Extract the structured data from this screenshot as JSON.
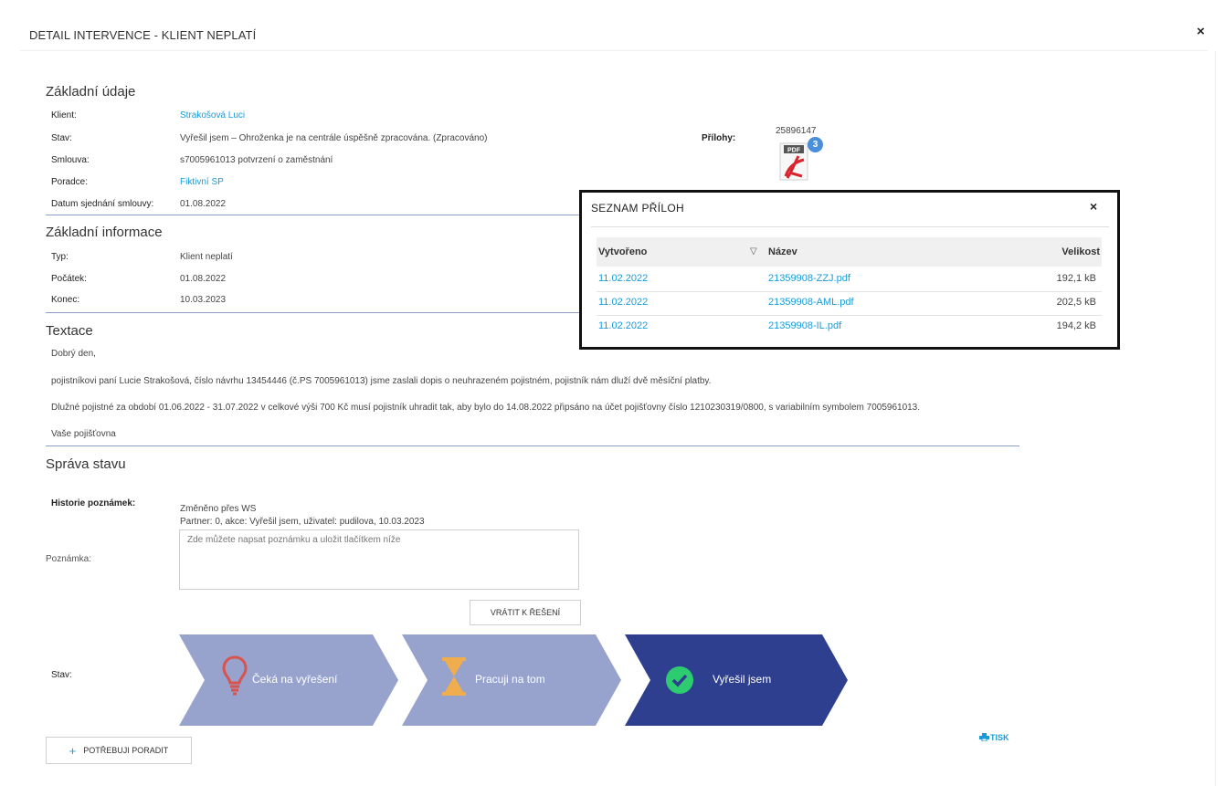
{
  "header": {
    "title": "DETAIL INTERVENCE - KLIENT NEPLATÍ",
    "close_icon": "×"
  },
  "basic": {
    "title": "Základní údaje",
    "fields": [
      {
        "label": "Klient:",
        "value": "Strakošová Luci",
        "link": true
      },
      {
        "label": "Stav:",
        "value": "Vyřešil jsem – Ohroženka je na centrále úspěšně zpracována. (Zpracováno)",
        "link": false
      },
      {
        "label": "Smlouva:",
        "value": "s7005961013 potvrzení o zaměstnání",
        "link": false
      },
      {
        "label": "Poradce:",
        "value": "Fiktivní SP",
        "link": true
      },
      {
        "label": "Datum sjednání smlouvy:",
        "value": "01.08.2022",
        "link": false
      }
    ]
  },
  "attachments": {
    "label": "Přílohy:",
    "number": "25896147",
    "pdf_label": "PDF",
    "count": "3"
  },
  "info": {
    "title": "Základní informace",
    "fields": [
      {
        "label": "Typ:",
        "value": "Klient neplatí"
      },
      {
        "label": "Počátek:",
        "value": "01.08.2022"
      },
      {
        "label": "Konec:",
        "value": "10.03.2023"
      }
    ]
  },
  "textace": {
    "title": "Textace",
    "lines": [
      "Dobrý den,",
      "pojistníkovi paní Lucie Strakošová, číslo návrhu 13454446 (č.PS 7005961013) jsme zaslali dopis o neuhrazeném pojistném, pojistník nám dluží dvě měsíční platby.",
      "Dlužné pojistné za období 01.06.2022 - 31.07.2022 v celkové výši 700 Kč musí pojistník uhradit tak, aby bylo do 14.08.2022 připsáno na účet pojišťovny číslo 1210230319/0800, s variabilním symbolem 7005961013.",
      "Vaše pojišťovna"
    ]
  },
  "sprava": {
    "title": "Správa stavu",
    "history_label": "Historie poznámek:",
    "history_line1": "Změněno přes WS",
    "history_line2": "Partner: 0, akce: Vyřešil jsem, uživatel: pudilova, 10.03.2023",
    "note_label": "Poznámka:",
    "note_placeholder": "Zde můžete napsat poznámku a uložit tlačítkem níže",
    "return_button": "VRÁTIT K ŘEŠENÍ",
    "state_label": "Stav:",
    "steps": [
      {
        "label": "Čeká na vyřešení",
        "icon": "lightbulb-icon",
        "color": "#97a3cd"
      },
      {
        "label": "Pracuji na tom",
        "icon": "hourglass-icon",
        "color": "#97a3cd"
      },
      {
        "label": "Vyřešil jsem",
        "icon": "check-circle-icon",
        "color": "#2e3f8f"
      }
    ],
    "help_button": "POTŘEBUJI PORADIT",
    "help_icon": "+",
    "print_label": "TISK"
  },
  "popup": {
    "title": "SEZNAM  PŘÍLOH",
    "close_icon": "×",
    "sort_icon": "▽",
    "columns": [
      "Vytvořeno",
      "Název",
      "Velikost"
    ],
    "rows": [
      {
        "created": "11.02.2022",
        "name": "21359908-ZZJ.pdf",
        "size": "192,1 kB"
      },
      {
        "created": "11.02.2022",
        "name": "21359908-AML.pdf",
        "size": "202,5 kB"
      },
      {
        "created": "11.02.2022",
        "name": "21359908-IL.pdf",
        "size": "194,2 kB"
      }
    ]
  },
  "colors": {
    "accent": "#1a9bd7",
    "step_light": "#97a3cd",
    "step_dark": "#2e3f8f",
    "bulb": "#d9534f",
    "hourglass": "#f0ad4e",
    "check": "#2ecc71"
  }
}
